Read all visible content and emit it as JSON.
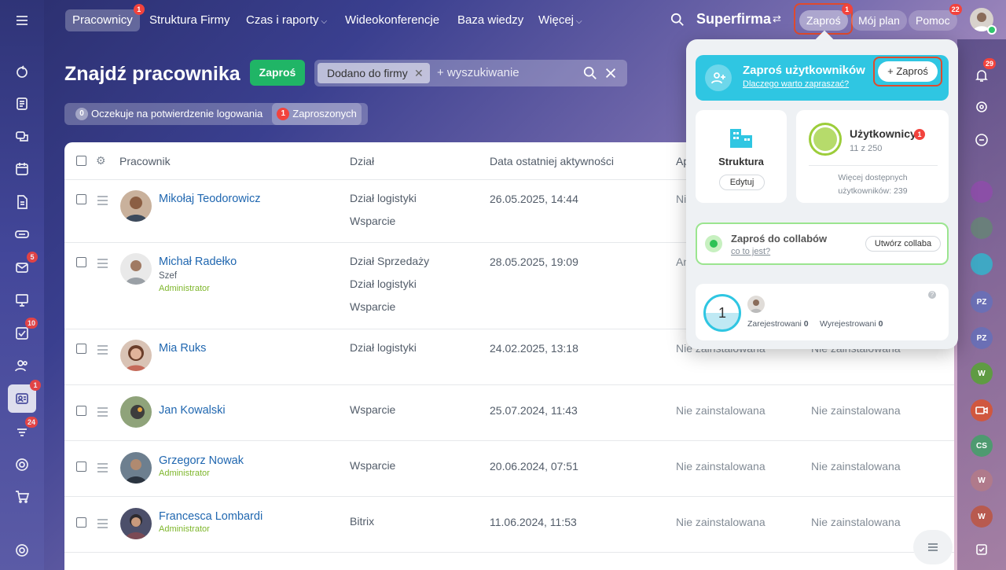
{
  "topbar": {
    "tabs": [
      {
        "label": "Pracownicy",
        "badge": "1"
      },
      {
        "label": "Struktura Firmy"
      },
      {
        "label": "Czas i raporty"
      },
      {
        "label": "Wideokonferencje"
      },
      {
        "label": "Baza wiedzy"
      },
      {
        "label": "Więcej"
      }
    ],
    "brand": "Superfirma",
    "invite_label": "Zaproś",
    "invite_badge": "1",
    "plan_label": "Mój plan",
    "help_label": "Pomoc",
    "help_badge": "22"
  },
  "rail": {
    "badges": {
      "mail": "5",
      "tasks": "10",
      "employees": "1",
      "feed": "24"
    }
  },
  "right_rail": {
    "notif_badge": "29",
    "avatars": [
      "PZ",
      "PZ",
      "W",
      "CS",
      "W",
      "W"
    ]
  },
  "main": {
    "title": "Znajdź pracownika",
    "invite_button": "Zaproś",
    "filter_chip": "Dodano do firmy",
    "search_placeholder": "+ wyszukiwanie",
    "filters": [
      {
        "count": "0",
        "label": "Oczekuje na potwierdzenie logowania"
      },
      {
        "count": "1",
        "label": "Zaproszonych"
      }
    ]
  },
  "table": {
    "headers": {
      "employee": "Pracownik",
      "department": "Dział",
      "last_activity": "Data ostatniej aktywności",
      "app": "Ap"
    },
    "rows": [
      {
        "name": "Mikołaj Teodorowicz",
        "sub": "",
        "role": "",
        "depts": [
          "Dział logistyki",
          "Wsparcie"
        ],
        "date": "26.05.2025, 14:44",
        "app": "Nie",
        "app2": ""
      },
      {
        "name": "Michał Radełko",
        "sub": "Szef",
        "role": "Administrator",
        "depts": [
          "Dział Sprzedaży",
          "Dział logistyki",
          "Wsparcie"
        ],
        "date": "28.05.2025, 19:09",
        "app": "An",
        "app2": ""
      },
      {
        "name": "Mia Ruks",
        "sub": "",
        "role": "",
        "depts": [
          "Dział logistyki"
        ],
        "date": "24.02.2025, 13:18",
        "app": "Nie zainstalowana",
        "app2": "Nie zainstalowana"
      },
      {
        "name": "Jan Kowalski",
        "sub": "",
        "role": "",
        "depts": [
          "Wsparcie"
        ],
        "date": "25.07.2024, 11:43",
        "app": "Nie zainstalowana",
        "app2": "Nie zainstalowana"
      },
      {
        "name": "Grzegorz Nowak",
        "sub": "",
        "role": "Administrator",
        "depts": [
          "Wsparcie"
        ],
        "date": "20.06.2024, 07:51",
        "app": "Nie zainstalowana",
        "app2": "Nie zainstalowana"
      },
      {
        "name": "Francesca Lombardi",
        "sub": "",
        "role": "Administrator",
        "depts": [
          "Bitrix"
        ],
        "date": "11.06.2024, 11:53",
        "app": "Nie zainstalowana",
        "app2": "Nie zainstalowana"
      }
    ]
  },
  "popup": {
    "invite_title": "Zaproś użytkowników",
    "invite_link": "Dlaczego warto zapraszać?",
    "invite_button": "+ Zaproś",
    "structure_title": "Struktura",
    "structure_button": "Edytuj",
    "users_title": "Użytkownicy",
    "users_badge": "1",
    "users_count": "11 z 250",
    "users_more": "Więcej dostępnych użytkowników: 239",
    "collab_title": "Zaproś do collabów",
    "collab_link": "co to jest?",
    "collab_button": "Utwórz collaba",
    "stats_number": "1",
    "registered_label": "Zarejestrowani",
    "registered_value": "0",
    "unregistered_label": "Wyrejestrowani",
    "unregistered_value": "0"
  },
  "colors": {
    "accent_green": "#20b566",
    "popup_cyan": "#2fc6e2",
    "badge_red": "#f2433d",
    "link_blue": "#2067b0",
    "admin_green": "#7eb62b",
    "highlight_outline": "#e04a2d"
  }
}
